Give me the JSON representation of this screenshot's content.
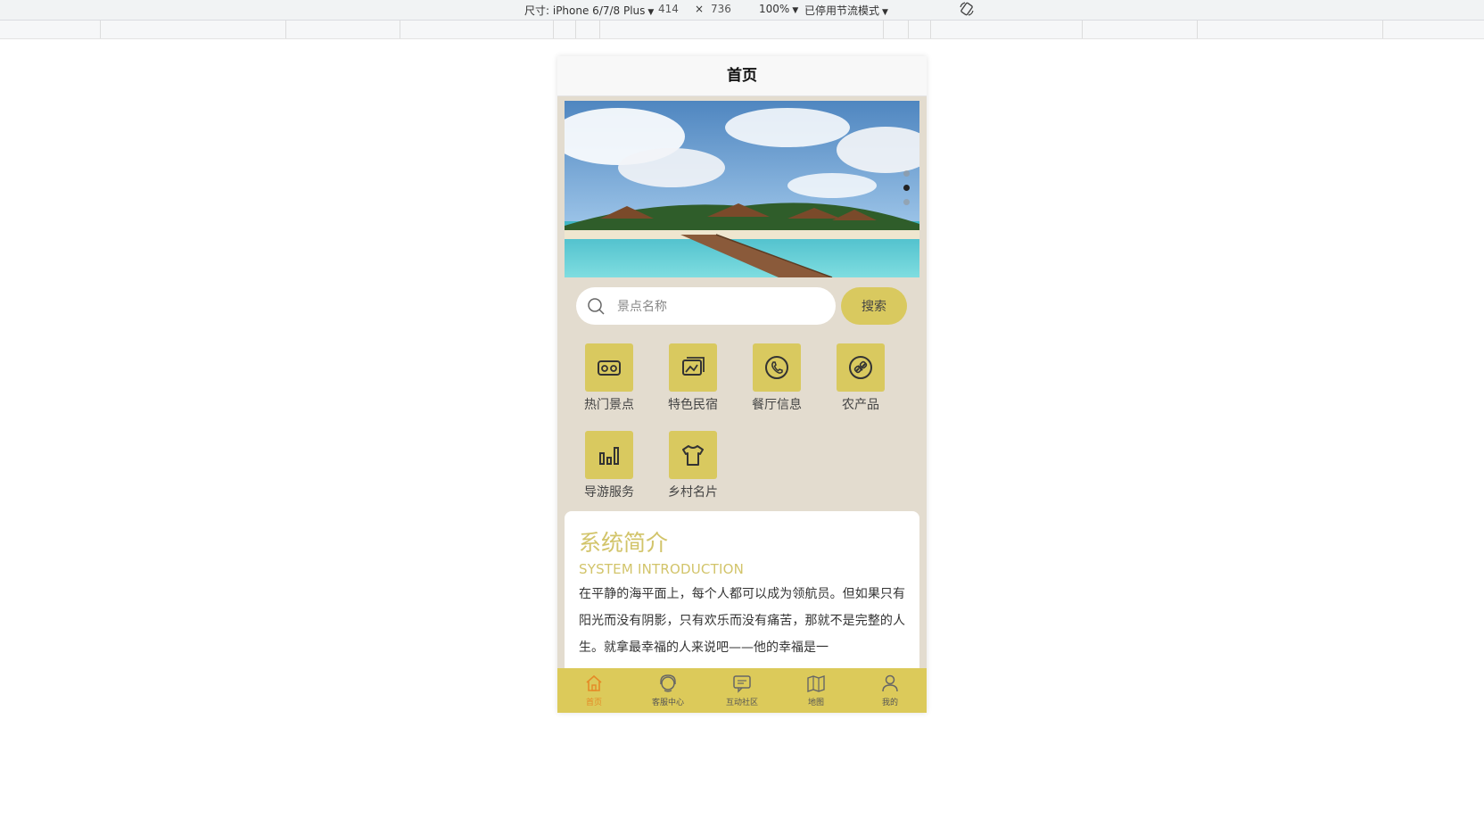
{
  "devtools": {
    "device_label": "尺寸: iPhone 6/7/8 Plus",
    "width": "414",
    "times": "×",
    "height": "736",
    "zoom": "100%",
    "throttle": "已停用节流模式"
  },
  "nav": {
    "title": "首页"
  },
  "banner": {
    "slides": 3,
    "active_slide": 2
  },
  "search": {
    "placeholder": "景点名称",
    "value": "",
    "button_label": "搜索"
  },
  "categories": [
    {
      "label": "热门景点",
      "icon": "vr-goggles-icon"
    },
    {
      "label": "特色民宿",
      "icon": "picture-icon"
    },
    {
      "label": "餐厅信息",
      "icon": "phone-icon"
    },
    {
      "label": "农产品",
      "icon": "link-icon"
    },
    {
      "label": "导游服务",
      "icon": "bar-chart-icon"
    },
    {
      "label": "乡村名片",
      "icon": "tshirt-icon"
    }
  ],
  "intro": {
    "title": "系统简介",
    "subtitle": "SYSTEM INTRODUCTION",
    "body": "在平静的海平面上，每个人都可以成为领航员。但如果只有阳光而没有阴影，只有欢乐而没有痛苦，那就不是完整的人生。就拿最幸福的人来说吧——他的幸福是一"
  },
  "tabbar": [
    {
      "label": "首页",
      "icon": "home-icon",
      "active": true
    },
    {
      "label": "客服中心",
      "icon": "headset-icon",
      "active": false
    },
    {
      "label": "互动社区",
      "icon": "chat-icon",
      "active": false
    },
    {
      "label": "地图",
      "icon": "map-icon",
      "active": false
    },
    {
      "label": "我的",
      "icon": "user-icon",
      "active": false
    }
  ],
  "colors": {
    "accent": "#d9c95f",
    "page_bg": "#e3dccf",
    "intro_title": "#d2c46a",
    "tab_active": "#e58a26"
  }
}
